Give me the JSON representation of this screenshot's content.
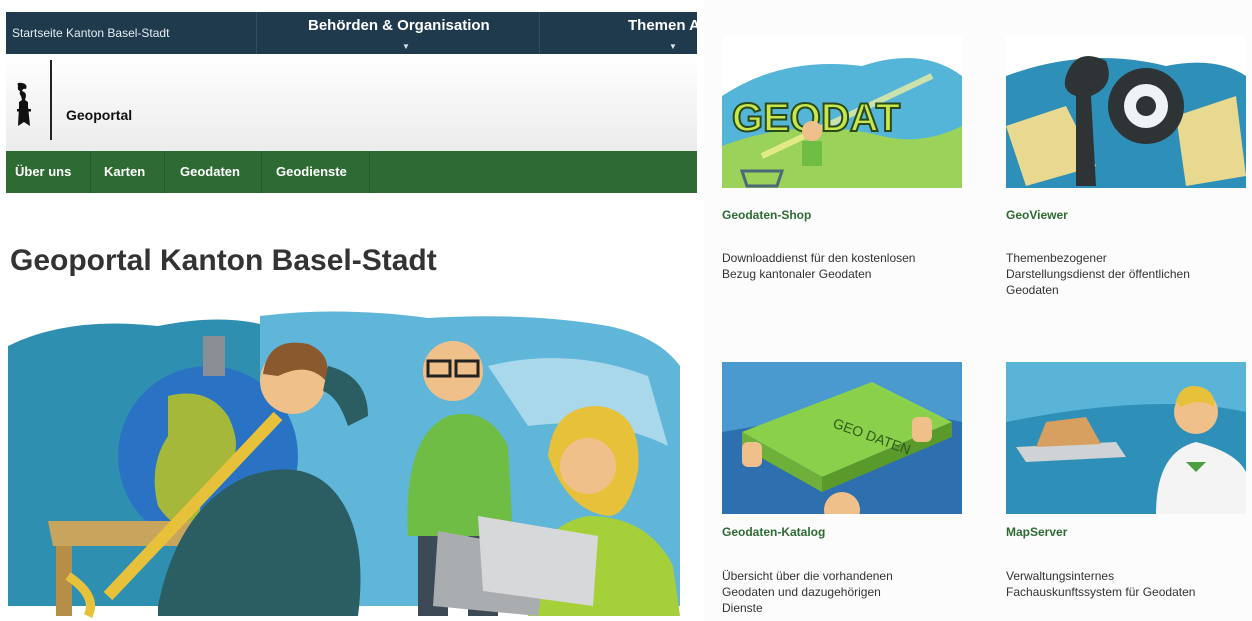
{
  "topbar": {
    "home_link": "Startseite Kanton Basel-Stadt",
    "nav": [
      {
        "label": "Behörden & Organisation"
      },
      {
        "label": "Themen A"
      }
    ]
  },
  "header": {
    "site_name": "Geoportal"
  },
  "mainnav": {
    "items": [
      "Über uns",
      "Karten",
      "Geodaten",
      "Geodienste"
    ]
  },
  "page": {
    "title": "Geoportal Kanton Basel-Stadt"
  },
  "tiles": [
    {
      "title": "Geodaten-Shop",
      "desc": [
        "Downloaddienst für den kostenlosen",
        "Bezug kantonaler Geodaten"
      ],
      "art_text": "GEODAT"
    },
    {
      "title": "GeoViewer",
      "desc": [
        "Themenbezogener",
        "Darstellungsdienst der öffentlichen",
        "Geodaten"
      ]
    },
    {
      "title": "Geodaten-Katalog",
      "desc": [
        "Übersicht über die vorhandenen",
        "Geodaten und dazugehörigen",
        "Dienste"
      ],
      "art_text": "GEO DATEN"
    },
    {
      "title": "MapServer",
      "desc": [
        "Verwaltungsinternes",
        "Fachauskunftssystem für Geodaten"
      ]
    }
  ],
  "colors": {
    "topbar": "#1e3a4c",
    "nav_green": "#2e6b33",
    "link_green": "#2e6b33"
  }
}
